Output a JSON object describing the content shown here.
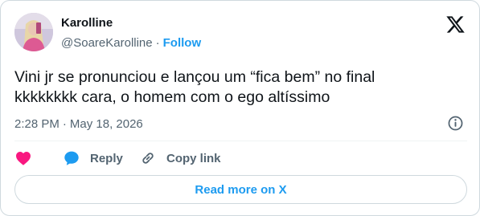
{
  "author": {
    "name": "Karolline",
    "handle": "@SoareKarolline",
    "separator": "·",
    "follow_label": "Follow"
  },
  "tweet": {
    "lines": [
      "Vini jr se pronunciou e lançou um “fica bem” no final",
      "kkkkkkkk cara, o homem com o ego altíssimo"
    ],
    "time": "2:28 PM",
    "separator": "·",
    "date": "May 18, 2026"
  },
  "actions": {
    "like_label": "",
    "reply_label": "Reply",
    "copy_link_label": "Copy link"
  },
  "read_more_label": "Read more on X",
  "icons": {
    "brand": "x-logo-icon",
    "like": "heart-icon",
    "reply": "speech-bubble-icon",
    "copy": "link-icon",
    "info": "info-icon"
  },
  "colors": {
    "accent": "#1d9bf0",
    "like": "#f91880",
    "text": "#0f1419",
    "secondary_text": "#536471",
    "border": "#cfd9de"
  }
}
